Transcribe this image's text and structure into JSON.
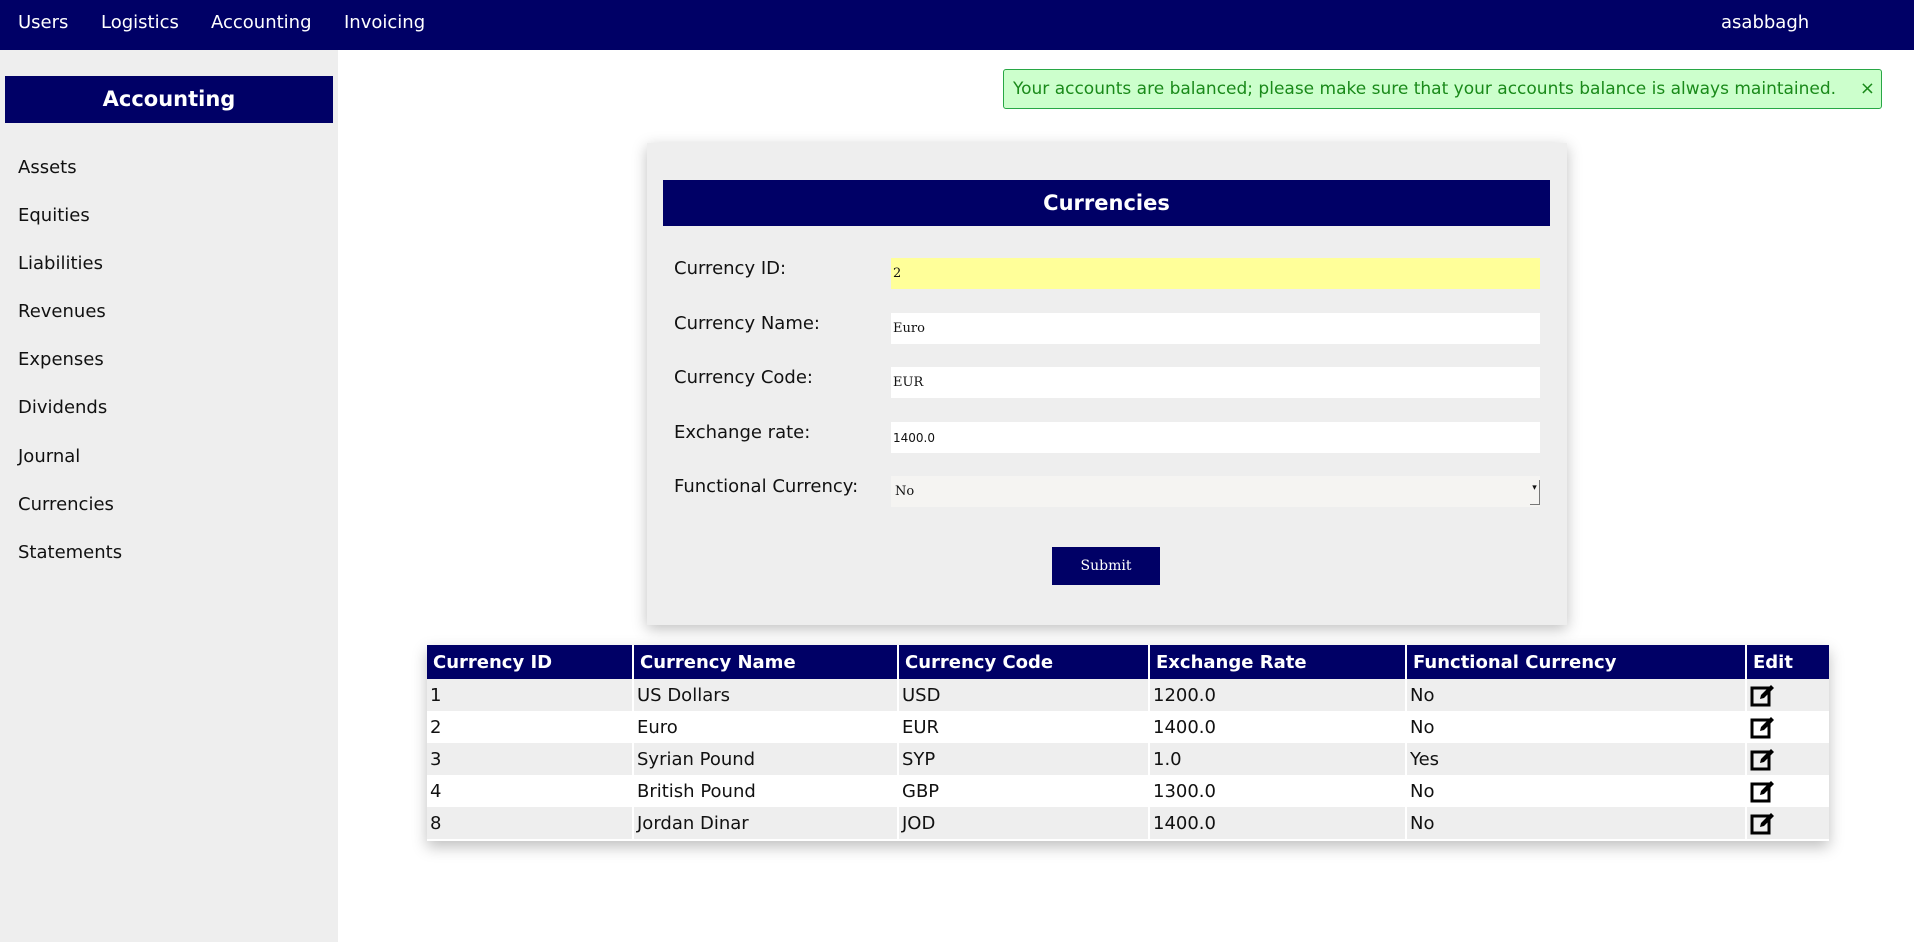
{
  "topnav": {
    "items": [
      "Users",
      "Logistics",
      "Accounting",
      "Invoicing"
    ],
    "user": "asabbagh"
  },
  "sidebar": {
    "title": "Accounting",
    "items": [
      "Assets",
      "Equities",
      "Liabilities",
      "Revenues",
      "Expenses",
      "Dividends",
      "Journal",
      "Currencies",
      "Statements"
    ]
  },
  "alert": {
    "message": "Your accounts are balanced; please make sure that your accounts balance is always maintained.",
    "close": "×"
  },
  "form": {
    "title": "Currencies",
    "labels": {
      "id": "Currency ID:",
      "name": "Currency Name:",
      "code": "Currency Code:",
      "rate": "Exchange rate:",
      "functional": "Functional Currency:"
    },
    "values": {
      "id": "2",
      "name": "Euro",
      "code": "EUR",
      "rate": "1400.0",
      "functional": "No"
    },
    "submit": "Submit"
  },
  "table": {
    "headers": [
      "Currency ID",
      "Currency Name",
      "Currency Code",
      "Exchange Rate",
      "Functional Currency",
      "Edit"
    ],
    "rows": [
      [
        "1",
        "US Dollars",
        "USD",
        "1200.0",
        "No"
      ],
      [
        "2",
        "Euro",
        "EUR",
        "1400.0",
        "No"
      ],
      [
        "3",
        "Syrian Pound",
        "SYP",
        "1.0",
        "Yes"
      ],
      [
        "4",
        "British Pound",
        "GBP",
        "1300.0",
        "No"
      ],
      [
        "8",
        "Jordan Dinar",
        "JOD",
        "1400.0",
        "No"
      ]
    ],
    "edit_icon": "edit-icon"
  },
  "colors": {
    "brand": "#000066",
    "alert_bg": "#ccffcc",
    "alert_text": "#1a8a1a",
    "highlight": "#ffff99"
  }
}
